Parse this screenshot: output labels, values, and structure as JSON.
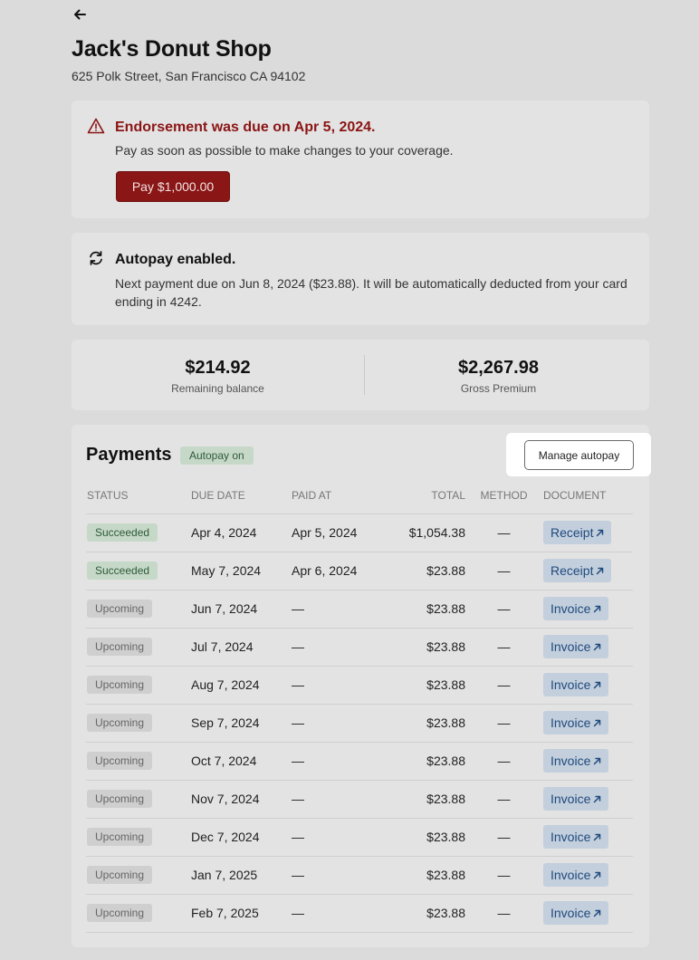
{
  "business": {
    "name": "Jack's Donut Shop",
    "address": "625 Polk Street, San Francisco CA 94102"
  },
  "alert": {
    "heading": "Endorsement was due on Apr 5, 2024.",
    "body": "Pay as soon as possible to make changes to your coverage.",
    "pay_label": "Pay $1,000.00",
    "color": "#8b1414"
  },
  "autopay": {
    "heading": "Autopay enabled.",
    "body": "Next payment due on Jun 8, 2024 ($23.88). It will be automatically deducted from your card ending in 4242."
  },
  "stats": {
    "remaining_value": "$214.92",
    "remaining_label": "Remaining balance",
    "gross_value": "$2,267.98",
    "gross_label": "Gross Premium"
  },
  "payments": {
    "title": "Payments",
    "badge": "Autopay on",
    "manage_label": "Manage autopay",
    "columns": [
      "STATUS",
      "DUE DATE",
      "PAID AT",
      "TOTAL",
      "METHOD",
      "DOCUMENT"
    ],
    "rows": [
      {
        "status": "Succeeded",
        "due": "Apr 4, 2024",
        "paid": "Apr 5, 2024",
        "total": "$1,054.38",
        "method": "—",
        "doc": "Receipt"
      },
      {
        "status": "Succeeded",
        "due": "May 7, 2024",
        "paid": "Apr 6, 2024",
        "total": "$23.88",
        "method": "—",
        "doc": "Receipt"
      },
      {
        "status": "Upcoming",
        "due": "Jun 7, 2024",
        "paid": "—",
        "total": "$23.88",
        "method": "—",
        "doc": "Invoice"
      },
      {
        "status": "Upcoming",
        "due": "Jul 7, 2024",
        "paid": "—",
        "total": "$23.88",
        "method": "—",
        "doc": "Invoice"
      },
      {
        "status": "Upcoming",
        "due": "Aug 7, 2024",
        "paid": "—",
        "total": "$23.88",
        "method": "—",
        "doc": "Invoice"
      },
      {
        "status": "Upcoming",
        "due": "Sep 7, 2024",
        "paid": "—",
        "total": "$23.88",
        "method": "—",
        "doc": "Invoice"
      },
      {
        "status": "Upcoming",
        "due": "Oct 7, 2024",
        "paid": "—",
        "total": "$23.88",
        "method": "—",
        "doc": "Invoice"
      },
      {
        "status": "Upcoming",
        "due": "Nov 7, 2024",
        "paid": "—",
        "total": "$23.88",
        "method": "—",
        "doc": "Invoice"
      },
      {
        "status": "Upcoming",
        "due": "Dec 7, 2024",
        "paid": "—",
        "total": "$23.88",
        "method": "—",
        "doc": "Invoice"
      },
      {
        "status": "Upcoming",
        "due": "Jan 7, 2025",
        "paid": "—",
        "total": "$23.88",
        "method": "—",
        "doc": "Invoice"
      },
      {
        "status": "Upcoming",
        "due": "Feb 7, 2025",
        "paid": "—",
        "total": "$23.88",
        "method": "—",
        "doc": "Invoice"
      }
    ]
  },
  "icons": {
    "back": "arrow-left-icon",
    "alert": "warning-triangle-icon",
    "autopay": "refresh-icon",
    "doc": "external-link-arrow-icon"
  }
}
